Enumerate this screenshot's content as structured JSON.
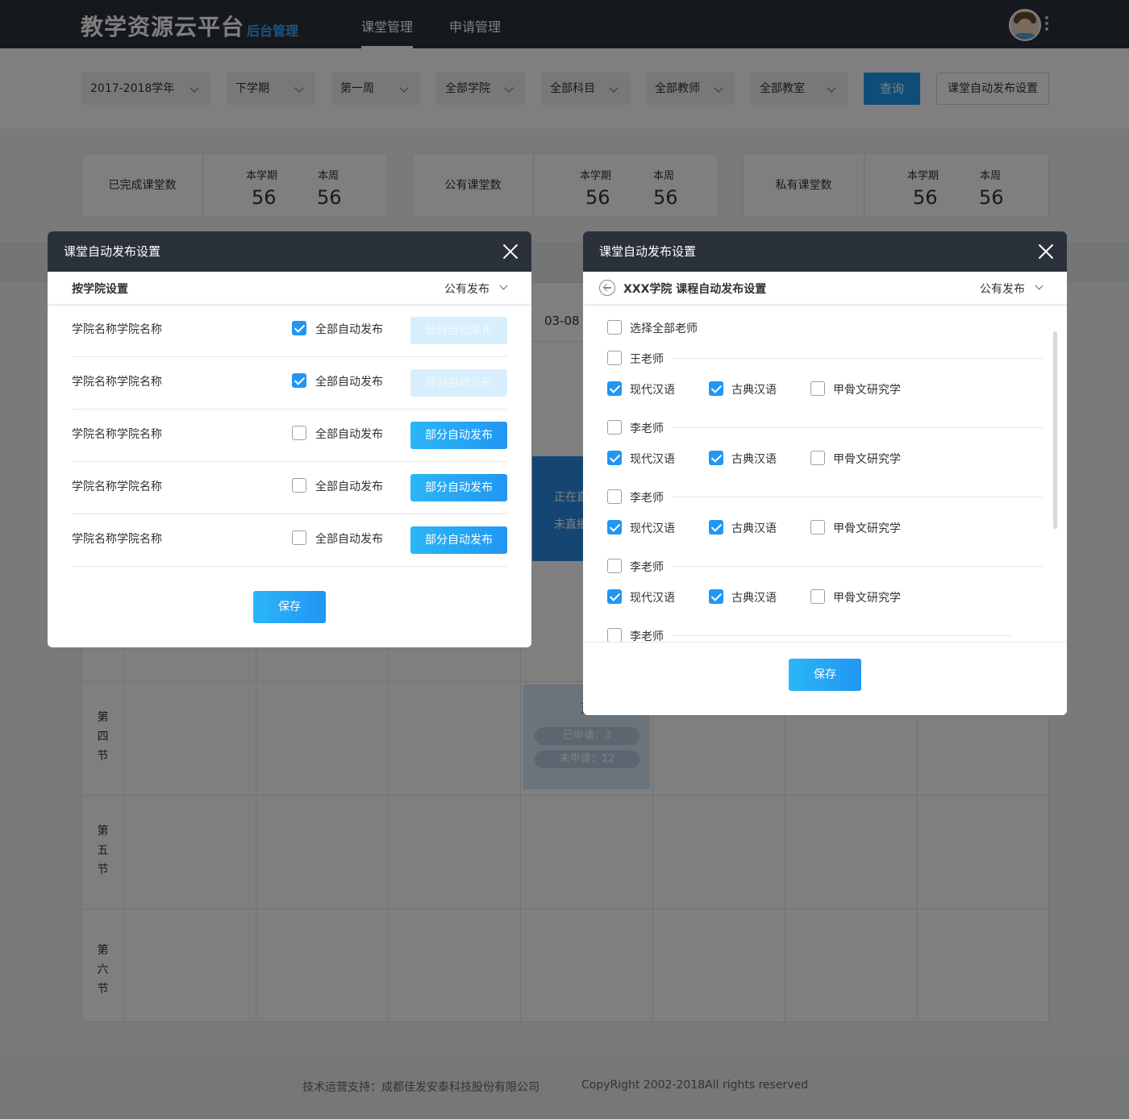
{
  "header": {
    "logo": "教学资源云平台",
    "logo_sub": "后台管理",
    "nav": [
      "课堂管理",
      "申请管理"
    ]
  },
  "filters": {
    "year": "2017-2018学年",
    "term": "下学期",
    "week": "第一周",
    "college": "全部学院",
    "subject": "全部科目",
    "teacher": "全部教师",
    "room": "全部教室",
    "query_label": "查询",
    "auto_publish_label": "课堂自动发布设置"
  },
  "stats": [
    {
      "label": "已完成课堂数",
      "term_label": "本学期",
      "week_label": "本周",
      "term_value": "56",
      "week_value": "56"
    },
    {
      "label": "公有课堂数",
      "term_label": "本学期",
      "week_label": "本周",
      "term_value": "56",
      "week_value": "56"
    },
    {
      "label": "私有课堂数",
      "term_label": "本学期",
      "week_label": "本周",
      "term_value": "56",
      "week_value": "56"
    }
  ],
  "schedule": {
    "date_header": "03-08",
    "periods": [
      "第\n四\n节",
      "第\n五\n节",
      "第\n六\n节"
    ],
    "live_card": {
      "line1": "正在直",
      "line2": "未直播"
    },
    "apply_card": {
      "title": "直",
      "applied": "已申请：3",
      "not_applied": "未申请：12"
    }
  },
  "footer": {
    "support": "技术运营支持：成都佳发安泰科技股份有限公司",
    "copyright": "CopyRight 2002-2018All rights reserved"
  },
  "modal_left": {
    "title": "课堂自动发布设置",
    "subtitle": "按学院设置",
    "mode": "公有发布",
    "rows": [
      {
        "name": "学院名称学院名称",
        "all_label": "全部自动发布",
        "all_checked": true,
        "part_label": "部分自动发布",
        "part_enabled": false
      },
      {
        "name": "学院名称学院名称",
        "all_label": "全部自动发布",
        "all_checked": true,
        "part_label": "部分自动发布",
        "part_enabled": false
      },
      {
        "name": "学院名称学院名称",
        "all_label": "全部自动发布",
        "all_checked": false,
        "part_label": "部分自动发布",
        "part_enabled": true
      },
      {
        "name": "学院名称学院名称",
        "all_label": "全部自动发布",
        "all_checked": false,
        "part_label": "部分自动发布",
        "part_enabled": true
      },
      {
        "name": "学院名称学院名称",
        "all_label": "全部自动发布",
        "all_checked": false,
        "part_label": "部分自动发布",
        "part_enabled": true
      }
    ],
    "save_label": "保存"
  },
  "modal_right": {
    "title": "课堂自动发布设置",
    "subtitle": "XXX学院 课程自动发布设置",
    "mode": "公有发布",
    "select_all_label": "选择全部老师",
    "teachers": [
      {
        "name": "王老师",
        "checked": false,
        "courses": [
          {
            "name": "现代汉语",
            "checked": true
          },
          {
            "name": "古典汉语",
            "checked": true
          },
          {
            "name": "甲骨文研究学",
            "checked": false
          }
        ]
      },
      {
        "name": "李老师",
        "checked": false,
        "courses": [
          {
            "name": "现代汉语",
            "checked": true
          },
          {
            "name": "古典汉语",
            "checked": true
          },
          {
            "name": "甲骨文研究学",
            "checked": false
          }
        ]
      },
      {
        "name": "李老师",
        "checked": false,
        "courses": [
          {
            "name": "现代汉语",
            "checked": true
          },
          {
            "name": "古典汉语",
            "checked": true
          },
          {
            "name": "甲骨文研究学",
            "checked": false
          }
        ]
      },
      {
        "name": "李老师",
        "checked": false,
        "courses": [
          {
            "name": "现代汉语",
            "checked": true
          },
          {
            "name": "古典汉语",
            "checked": true
          },
          {
            "name": "甲骨文研究学",
            "checked": false
          }
        ]
      },
      {
        "name": "李老师",
        "checked": false,
        "courses": []
      }
    ],
    "save_label": "保存"
  }
}
